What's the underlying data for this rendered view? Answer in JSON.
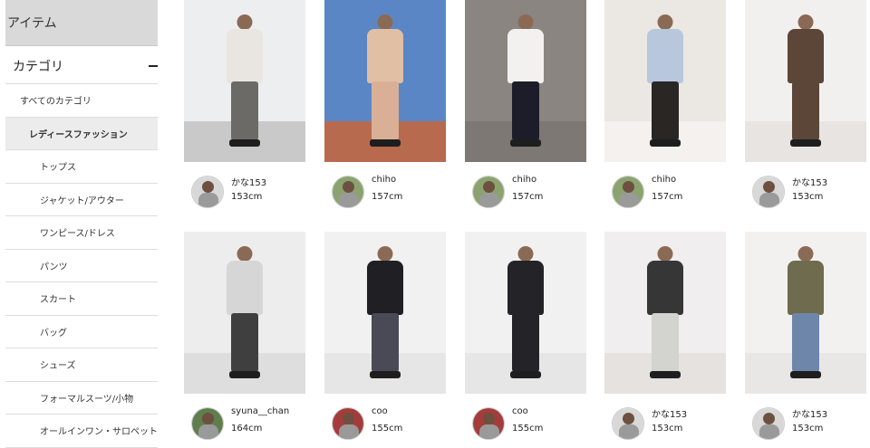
{
  "sidebar": {
    "header": "アイテム",
    "category_label": "カテゴリ",
    "items": [
      {
        "label": "すべてのカテゴリ",
        "level": "lvl1"
      },
      {
        "label": "レディースファッション",
        "level": "lvl1b"
      },
      {
        "label": "トップス",
        "level": "lvl2"
      },
      {
        "label": "ジャケット/アウター",
        "level": "lvl2"
      },
      {
        "label": "ワンピース/ドレス",
        "level": "lvl2"
      },
      {
        "label": "パンツ",
        "level": "lvl2"
      },
      {
        "label": "スカート",
        "level": "lvl2"
      },
      {
        "label": "バッグ",
        "level": "lvl2"
      },
      {
        "label": "シューズ",
        "level": "lvl2"
      },
      {
        "label": "フォーマルスーツ/小物",
        "level": "lvl2"
      },
      {
        "label": "オールインワン・サロペット",
        "level": "lvl2"
      }
    ]
  },
  "cards": [
    {
      "user": "かな153",
      "height": "153cm",
      "wall": "#eceef0",
      "floor": "#c9c9c9",
      "top": "#e9e6e1",
      "bottom": "#6c6a66",
      "avatar_bg": "#d8d8d8"
    },
    {
      "user": "chiho",
      "height": "157cm",
      "wall": "#5b86c6",
      "floor": "#b86a4e",
      "top": "#e0bfa5",
      "bottom": "#d9b096",
      "avatar_bg": "#8aa36f"
    },
    {
      "user": "chiho",
      "height": "157cm",
      "wall": "#8a8580",
      "floor": "#7d7873",
      "top": "#f3f1ef",
      "bottom": "#1d1d2a",
      "avatar_bg": "#8aa36f"
    },
    {
      "user": "chiho",
      "height": "157cm",
      "wall": "#ebe7e2",
      "floor": "#f4f1ee",
      "top": "#b9c7dd",
      "bottom": "#2a2624",
      "avatar_bg": "#8aa36f"
    },
    {
      "user": "かな153",
      "height": "153cm",
      "wall": "#f2f0ef",
      "floor": "#e8e4e1",
      "top": "#5b4637",
      "bottom": "#5b4637",
      "avatar_bg": "#d8d8d8"
    },
    {
      "user": "syuna__chan",
      "height": "164cm",
      "wall": "#ededed",
      "floor": "#dedede",
      "top": "#d6d6d6",
      "bottom": "#3f3f3f",
      "avatar_bg": "#5f7d4d"
    },
    {
      "user": "coo",
      "height": "155cm",
      "wall": "#f1f1f1",
      "floor": "#e6e6e6",
      "top": "#1f1f24",
      "bottom": "#4a4a56",
      "avatar_bg": "#a43c3c"
    },
    {
      "user": "coo",
      "height": "155cm",
      "wall": "#f1f1f1",
      "floor": "#e6e6e6",
      "top": "#242428",
      "bottom": "#242428",
      "avatar_bg": "#a43c3c"
    },
    {
      "user": "かな153",
      "height": "153cm",
      "wall": "#f0eeee",
      "floor": "#e5e2e0",
      "top": "#363636",
      "bottom": "#d3d3cf",
      "avatar_bg": "#d8d8d8"
    },
    {
      "user": "かな153",
      "height": "153cm",
      "wall": "#f2f1f0",
      "floor": "#e9e7e5",
      "top": "#6f6b4e",
      "bottom": "#6d86aa",
      "avatar_bg": "#d8d8d8"
    }
  ]
}
